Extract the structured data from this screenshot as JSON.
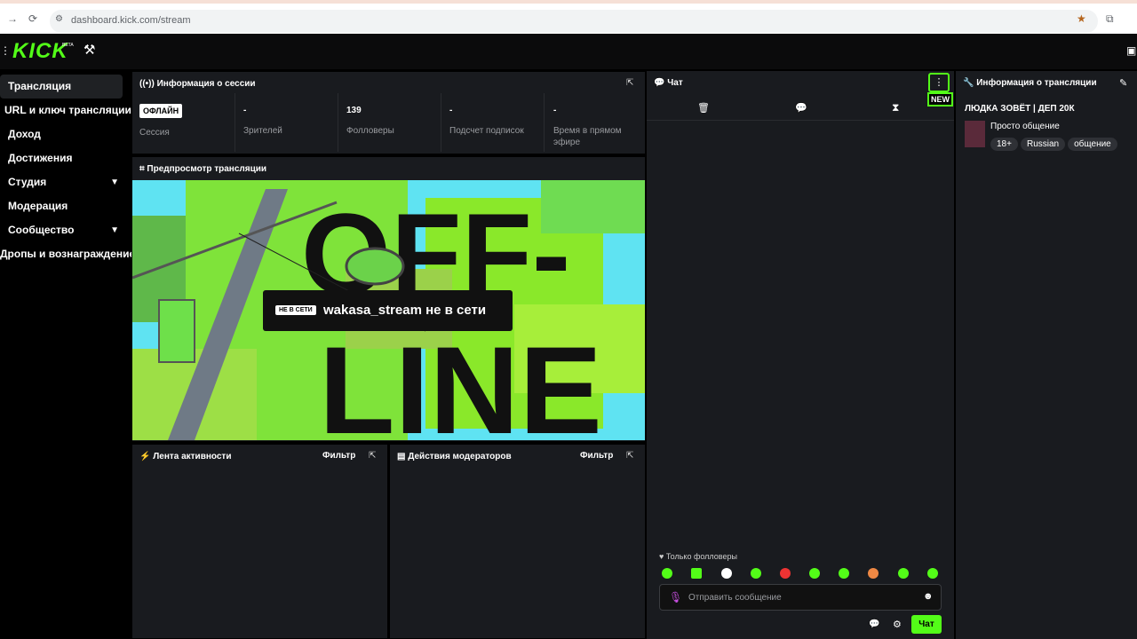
{
  "browser": {
    "url": "dashboard.kick.com/stream"
  },
  "brand": {
    "logo": "KICK",
    "beta": "BETA",
    "accent": "#53fc18"
  },
  "sidebar": {
    "items": [
      {
        "label": "Трансляция"
      },
      {
        "label": "URL и ключ трансляции"
      },
      {
        "label": "Доход"
      },
      {
        "label": "Достижения"
      },
      {
        "label": "Студия"
      },
      {
        "label": "Модерация"
      },
      {
        "label": "Сообщество"
      },
      {
        "label": "Дропы и вознаграждение"
      }
    ]
  },
  "session": {
    "title": "Информация о сессии",
    "status_badge": "ОФЛАЙН",
    "status_label": "Сессия",
    "viewers_value": "-",
    "viewers_label": "Зрителей",
    "followers_value": "139",
    "followers_label": "Фолловеры",
    "subs_value": "-",
    "subs_label": "Подсчет подписок",
    "uptime_value": "-",
    "uptime_label": "Время в прямом эфире"
  },
  "preview": {
    "title": "Предпросмотр трансляции",
    "offline_tag": "НЕ В СЕТИ",
    "offline_text": "wakasa_stream не в сети"
  },
  "activity": {
    "title": "Лента активности",
    "filter": "Фильтр"
  },
  "modactions": {
    "title": "Действия модераторов",
    "filter": "Фильтр"
  },
  "chat": {
    "title": "Чат",
    "new_badge": "NEW",
    "followers_only": "Только фолловеры",
    "placeholder": "Отправить сообщение",
    "send_label": "Чат"
  },
  "streaminfo": {
    "title": "Информация о трансляции",
    "stream_title": "ЛЮДКА ЗОВЁТ | ДЕП 20К",
    "category": "Просто общение",
    "tags": [
      "18+",
      "Russian",
      "общение"
    ]
  }
}
